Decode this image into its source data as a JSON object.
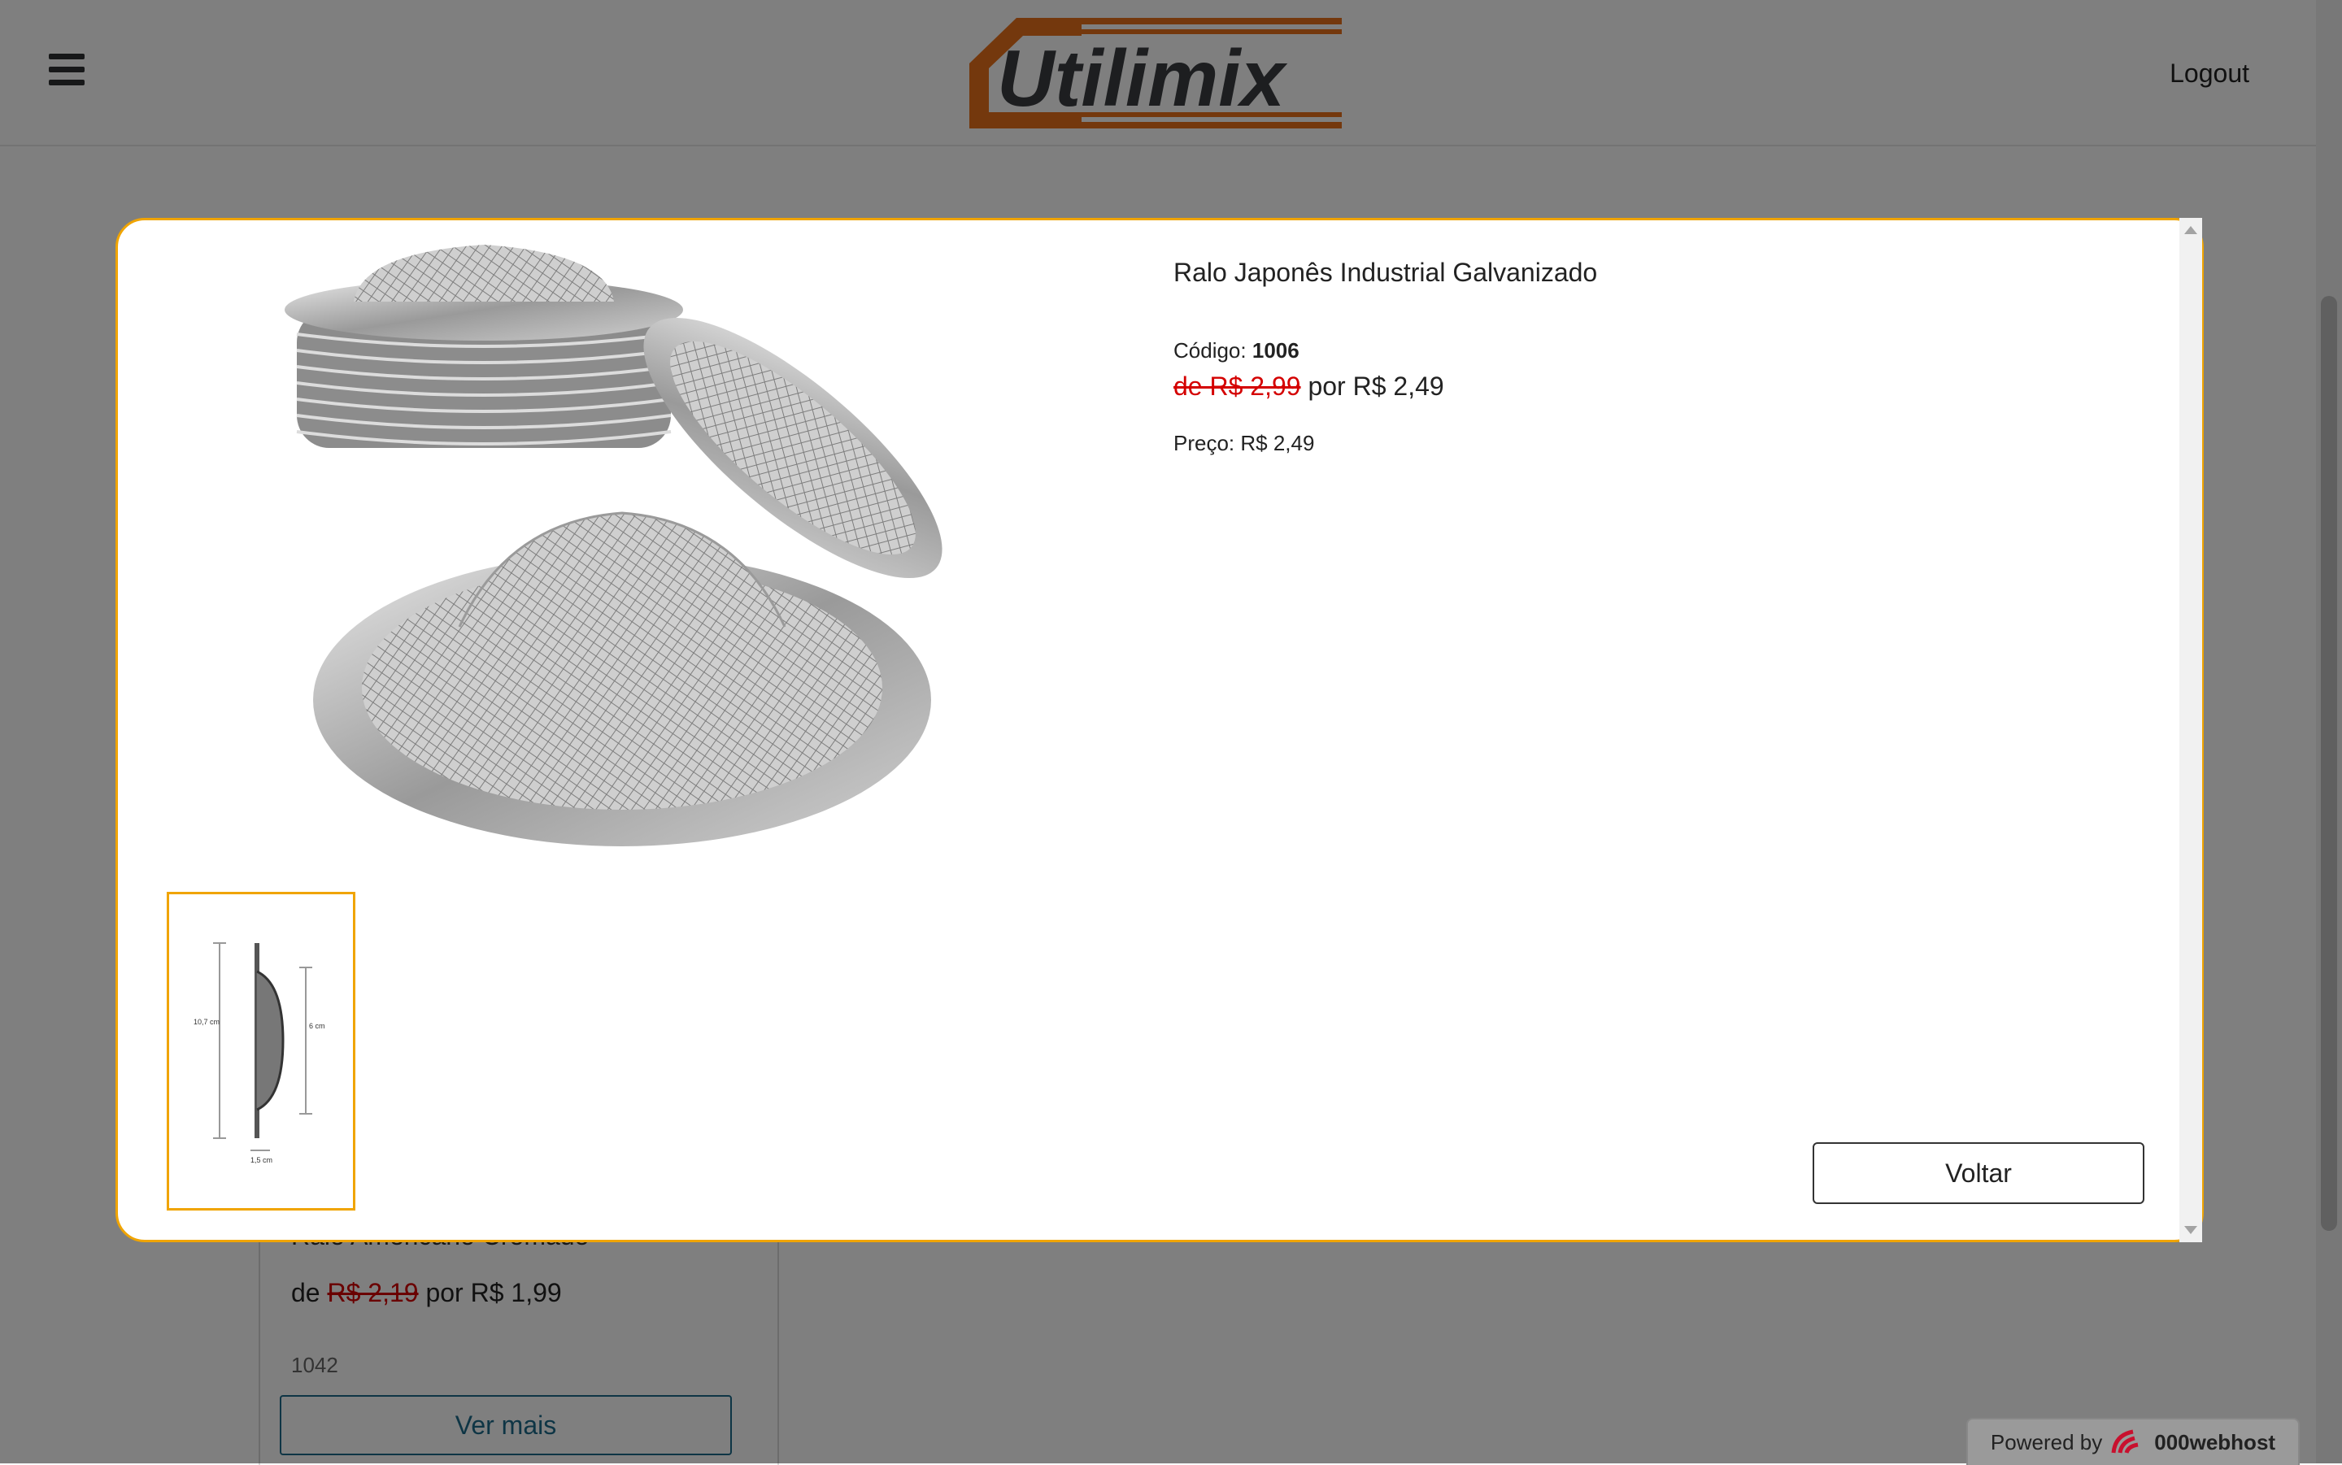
{
  "header": {
    "logo_text": "Utilimix",
    "logout_label": "Logout"
  },
  "background_card": {
    "name": "Ralo Americano Cromado",
    "price_prefix": "de",
    "old_price": "R$ 2,19",
    "price_mid": "por",
    "new_price": "R$ 1,99",
    "code": "1042",
    "button_label": "Ver mais"
  },
  "footer": {
    "powered_label": "Powered by",
    "brand": "000webhost"
  },
  "modal": {
    "title": "Ralo Japonês Industrial Galvanizado",
    "code_label": "Código:",
    "code_value": "1006",
    "old_price_label": "de R$ 2,99",
    "new_price_label": "por R$ 2,49",
    "price_label": "Preço:",
    "price_value": "R$ 2,49",
    "thumbnail_dims": {
      "height_label": "10,7 cm",
      "depth_label": "6 cm",
      "width_label": "1,5 cm"
    },
    "back_button_label": "Voltar"
  },
  "colors": {
    "accent": "#f0a400",
    "old_price": "#d40000",
    "link": "#1d6b8a",
    "logo_orange": "#e8701a"
  }
}
